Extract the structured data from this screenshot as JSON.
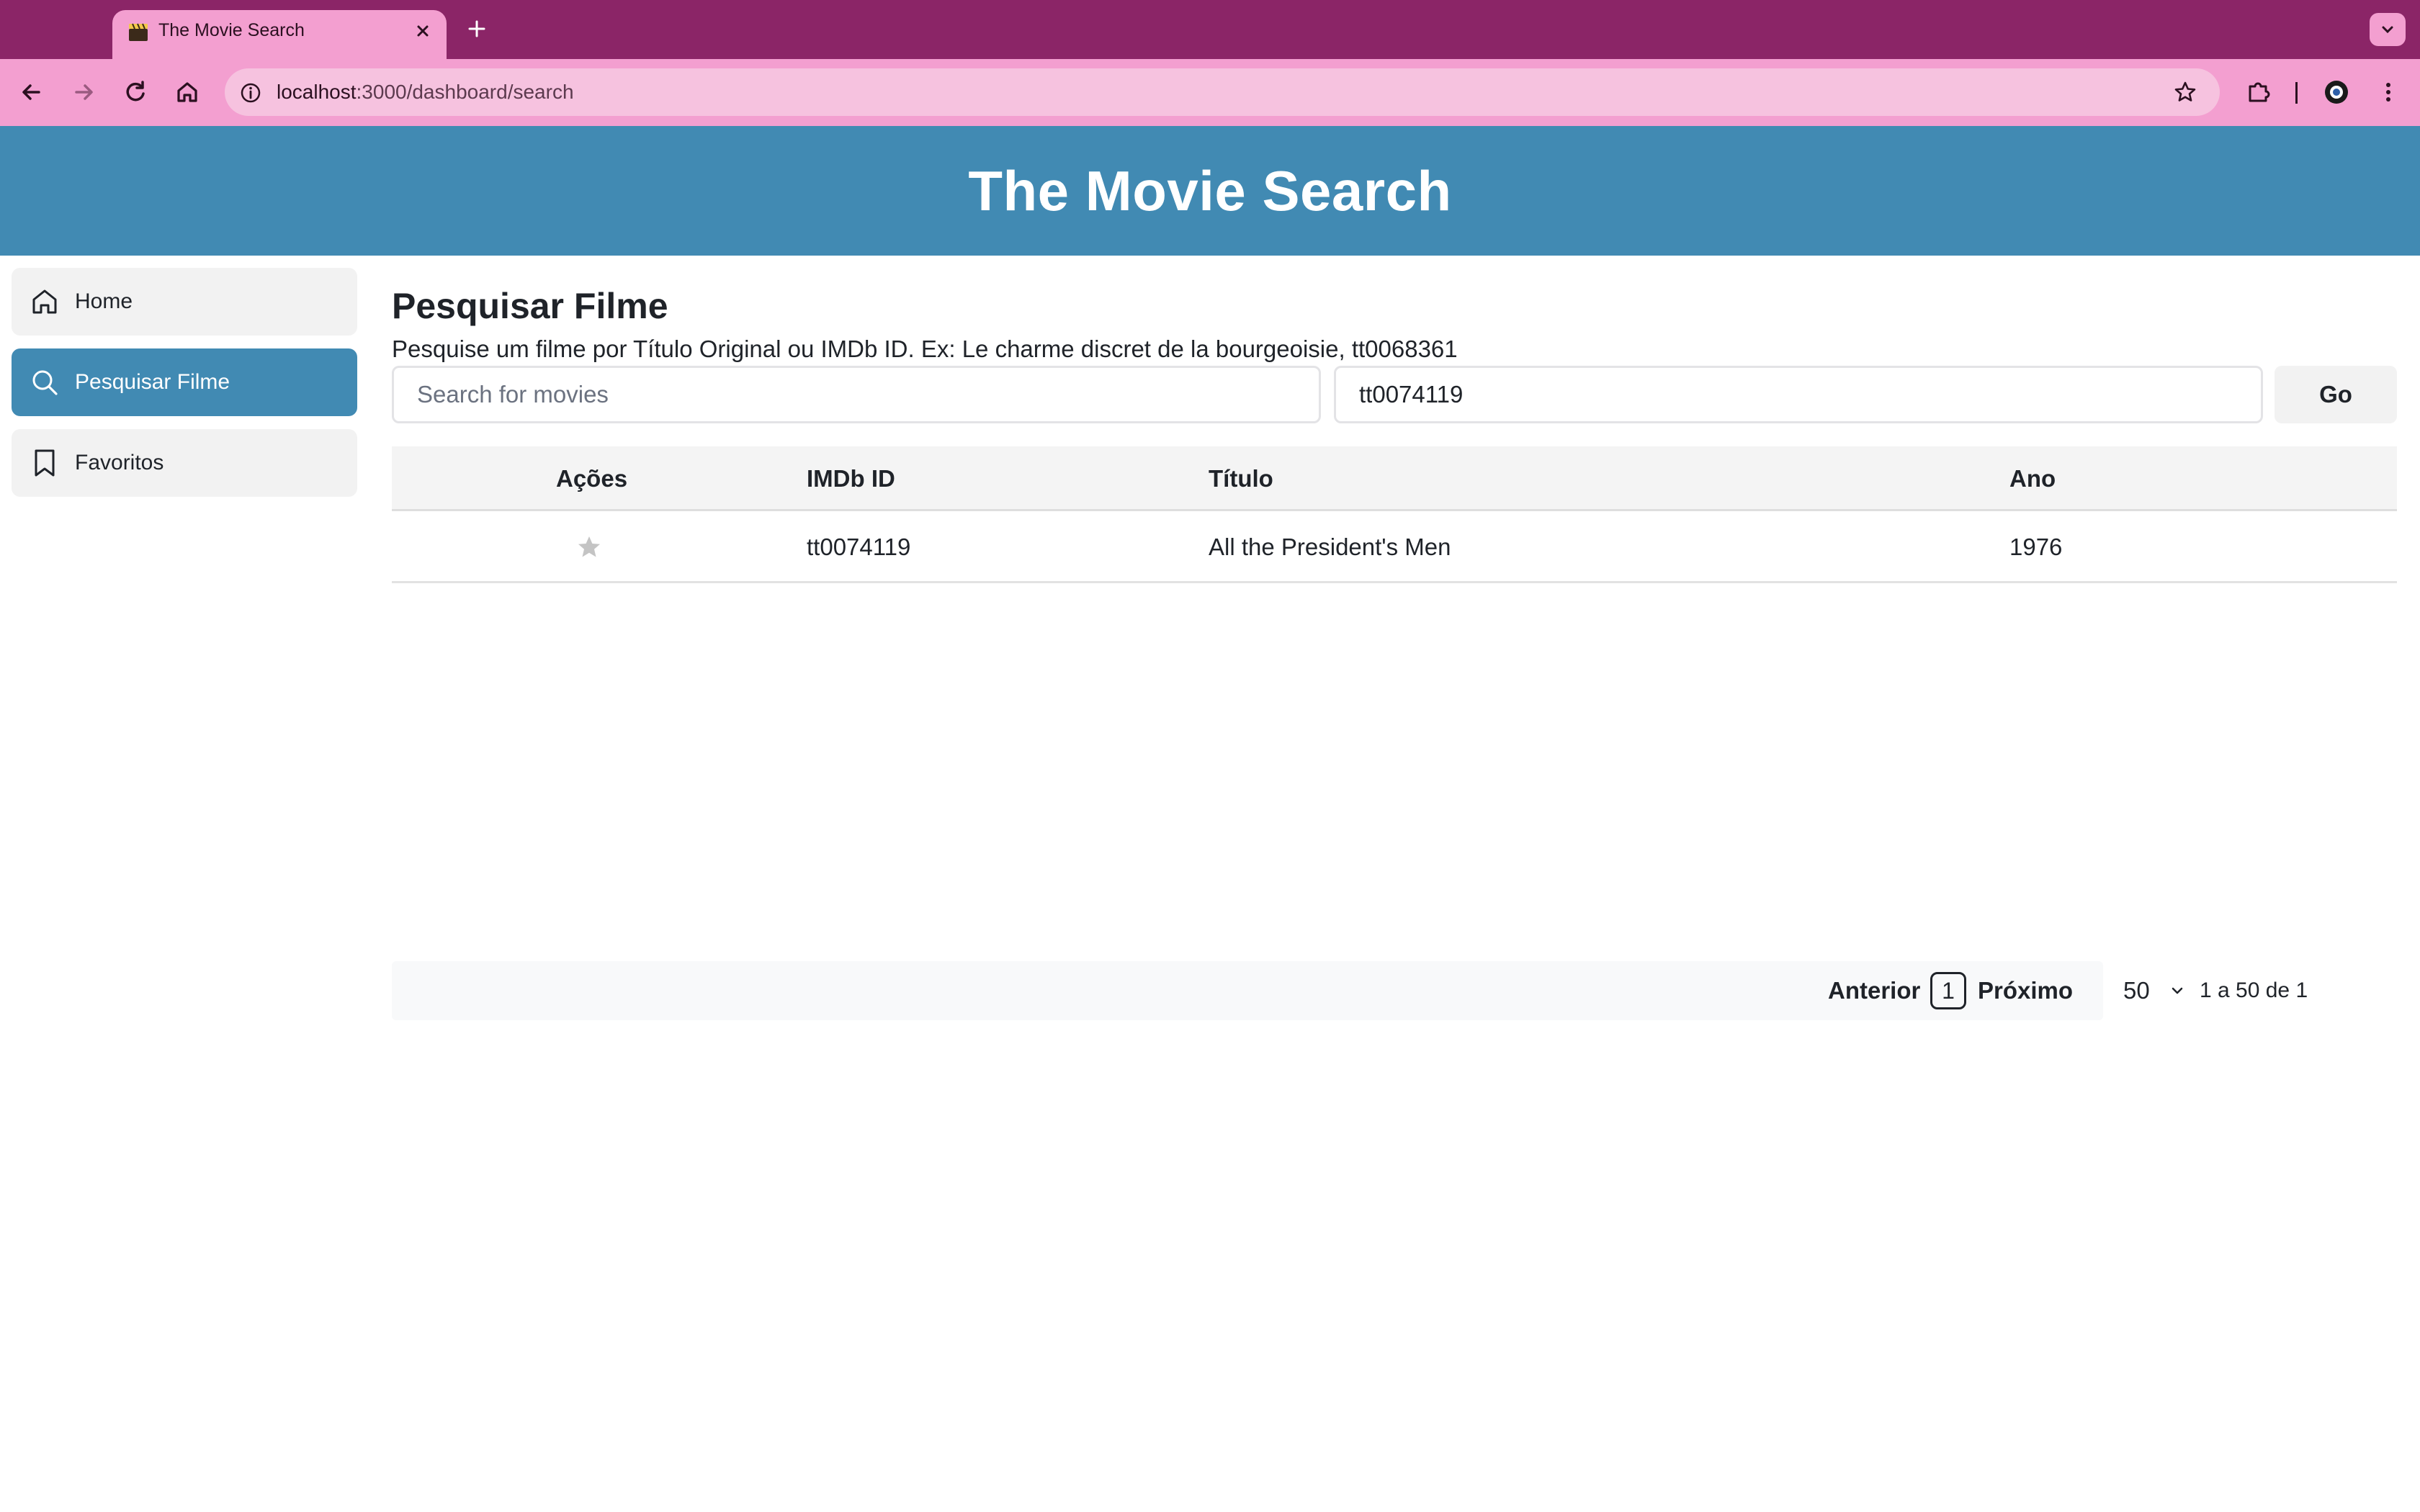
{
  "browser": {
    "tab_title": "The Movie Search",
    "url_host": "localhost",
    "url_rest": ":3000/dashboard/search"
  },
  "app": {
    "title": "The Movie Search"
  },
  "sidebar": {
    "items": [
      {
        "label": "Home",
        "icon": "home-icon",
        "active": false
      },
      {
        "label": "Pesquisar Filme",
        "icon": "search-icon",
        "active": true
      },
      {
        "label": "Favoritos",
        "icon": "bookmark-icon",
        "active": false
      }
    ]
  },
  "search": {
    "title": "Pesquisar Filme",
    "description": "Pesquise um filme por Título Original ou IMDb ID. Ex: Le charme discret de la bourgeoisie, tt0068361",
    "title_placeholder": "Search for movies",
    "title_value": "",
    "id_value": "tt0074119",
    "go_label": "Go"
  },
  "table": {
    "headers": {
      "actions": "Ações",
      "imdb_id": "IMDb ID",
      "title": "Título",
      "year": "Ano"
    },
    "rows": [
      {
        "imdb_id": "tt0074119",
        "title": "All the President's Men",
        "year": "1976",
        "favorited": false
      }
    ]
  },
  "pagination": {
    "prev_label": "Anterior",
    "current_page": "1",
    "next_label": "Próximo",
    "page_size": "50",
    "range_text": "1 a 50 de 1"
  },
  "colors": {
    "browser_frame": "#8b2567",
    "browser_toolbar": "#f39fd0",
    "app_header": "#418ab3",
    "sidebar_active": "#418ab3",
    "sidebar_item": "#f2f2f2"
  }
}
